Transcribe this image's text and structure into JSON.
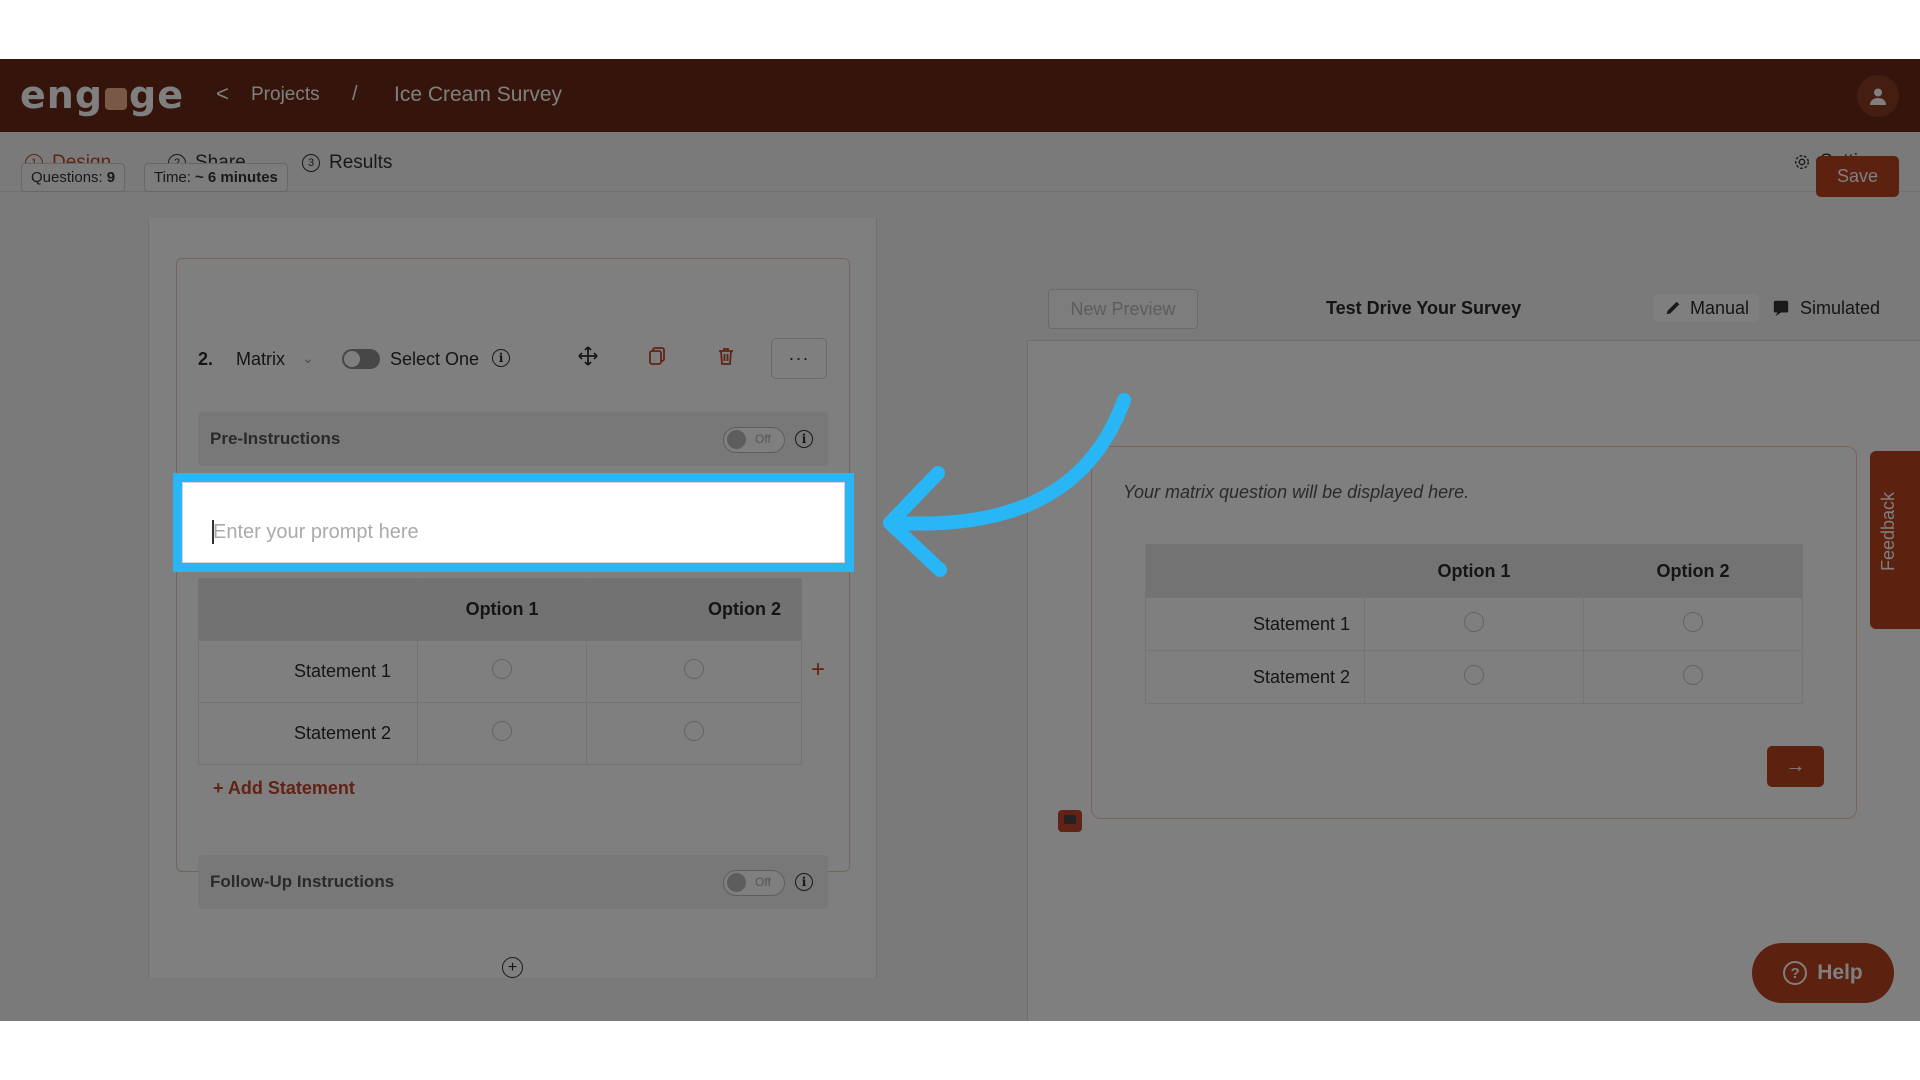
{
  "app": {
    "logo_text": "engage",
    "breadcrumb": {
      "back": "<",
      "projects": "Projects",
      "separator": "/",
      "current": "Ice Cream Survey"
    }
  },
  "tabs": [
    {
      "num": "1",
      "label": "Design",
      "active": true
    },
    {
      "num": "2",
      "label": "Share"
    },
    {
      "num": "3",
      "label": "Results"
    }
  ],
  "settings_label": "Settings",
  "stats": {
    "questions_label": "Questions:",
    "questions_value": "9",
    "time_label": "Time:",
    "time_value": "~ 6 minutes"
  },
  "save_label": "Save",
  "question": {
    "number": "2.",
    "type": "Matrix",
    "select_mode": "Select One",
    "pre_instructions_label": "Pre-Instructions",
    "pre_toggle": "Off",
    "prompt_placeholder": "Enter your prompt here",
    "columns": [
      "Option 1",
      "Option 2"
    ],
    "statements": [
      "Statement 1",
      "Statement 2"
    ],
    "add_statement_label": "+ Add Statement",
    "follow_up_label": "Follow-Up Instructions",
    "follow_toggle": "Off"
  },
  "preview": {
    "new_preview_label": "New Preview",
    "title": "Test Drive Your Survey",
    "mode_manual": "Manual",
    "mode_simulated": "Simulated",
    "message": "Your matrix question will be displayed here.",
    "columns": [
      "Option 1",
      "Option 2"
    ],
    "statements": [
      "Statement 1",
      "Statement 2"
    ]
  },
  "feedback_label": "Feedback",
  "help_label": "Help",
  "colors": {
    "brand": "#6b2a16",
    "accent": "#b8431f",
    "highlight": "#29b6f6"
  }
}
